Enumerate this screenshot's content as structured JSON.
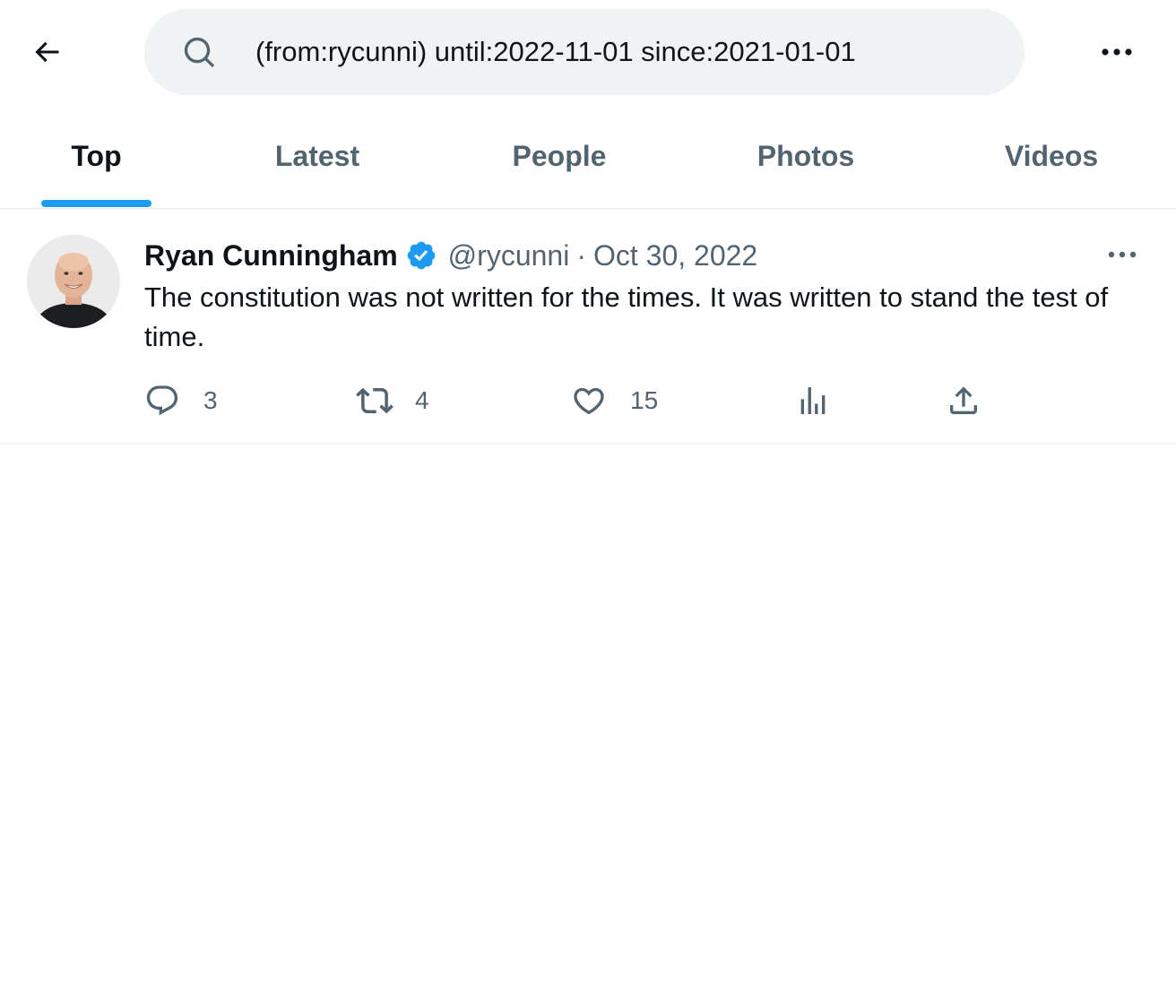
{
  "search": {
    "query": "(from:rycunni) until:2022-11-01 since:2021-01-01"
  },
  "tabs": [
    {
      "label": "Top",
      "active": true
    },
    {
      "label": "Latest",
      "active": false
    },
    {
      "label": "People",
      "active": false
    },
    {
      "label": "Photos",
      "active": false
    },
    {
      "label": "Videos",
      "active": false
    }
  ],
  "tweet": {
    "display_name": "Ryan Cunningham",
    "handle": "@rycunni",
    "separator": "·",
    "date": "Oct 30, 2022",
    "text": "The constitution was not written for the times.  It was written to stand the test of time.",
    "replies": "3",
    "retweets": "4",
    "likes": "15"
  },
  "colors": {
    "accent": "#1d9bf0",
    "text_primary": "#0f1419",
    "text_secondary": "#536471",
    "search_bg": "#eff3f4"
  },
  "icons": {
    "back": "arrow-left-icon",
    "search": "search-icon",
    "more": "more-horizontal-icon",
    "verified": "verified-badge-icon",
    "reply": "reply-icon",
    "retweet": "retweet-icon",
    "like": "heart-icon",
    "analytics": "analytics-icon",
    "share": "share-icon"
  }
}
